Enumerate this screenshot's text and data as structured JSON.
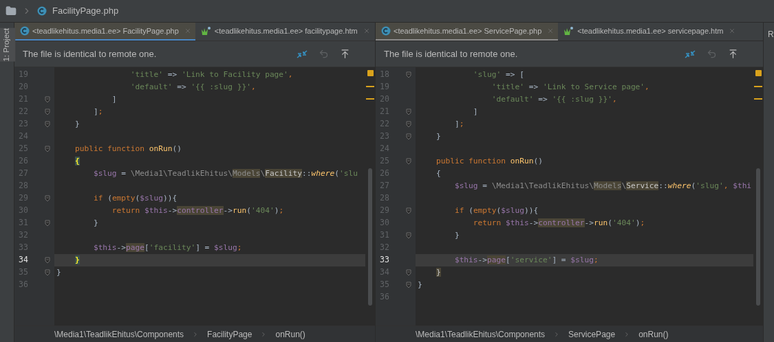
{
  "breadcrumb": {
    "file": "FacilityPage.php"
  },
  "left_strip": {
    "label": "1: Project"
  },
  "right_strip": {
    "label": "R"
  },
  "panes": [
    {
      "active": true,
      "tabs": [
        {
          "kind": "php",
          "label": "<teadlikehitus.media1.ee> FacilityPage.php",
          "selected": true
        },
        {
          "kind": "htm",
          "label": "<teadlikehitus.media1.ee> facilitypage.htm",
          "selected": false
        }
      ],
      "notice": "The file is identical to remote one.",
      "lines": [
        {
          "number": "19",
          "fold": false,
          "current": false,
          "tokens": [
            {
              "kind": "string",
              "text": "                'title'"
            },
            {
              "kind": "plain",
              "text": " => "
            },
            {
              "kind": "string",
              "text": "'Link to Facility page'"
            },
            {
              "kind": "punct",
              "text": ","
            }
          ]
        },
        {
          "number": "20",
          "fold": false,
          "current": false,
          "tokens": [
            {
              "kind": "string",
              "text": "                'default'"
            },
            {
              "kind": "plain",
              "text": " => "
            },
            {
              "kind": "string",
              "text": "'{{ :slug }}'"
            },
            {
              "kind": "punct",
              "text": ","
            }
          ]
        },
        {
          "number": "21",
          "fold": true,
          "current": false,
          "tokens": [
            {
              "kind": "plain",
              "text": "            ]"
            }
          ]
        },
        {
          "number": "22",
          "fold": true,
          "current": false,
          "tokens": [
            {
              "kind": "plain",
              "text": "        ]"
            },
            {
              "kind": "punct",
              "text": ";"
            }
          ]
        },
        {
          "number": "23",
          "fold": true,
          "current": false,
          "tokens": [
            {
              "kind": "plain",
              "text": "    }"
            }
          ]
        },
        {
          "number": "24",
          "fold": false,
          "current": false
        },
        {
          "number": "25",
          "fold": true,
          "current": false,
          "tokens": [
            {
              "kind": "keyword",
              "text": "    public function "
            },
            {
              "kind": "func",
              "text": "onRun"
            },
            {
              "kind": "plain",
              "text": "()"
            }
          ]
        },
        {
          "number": "26",
          "fold": false,
          "current": false,
          "tokens": [
            {
              "kind": "brace_match",
              "text": "    {"
            }
          ]
        },
        {
          "number": "27",
          "fold": false,
          "current": false,
          "tokens": [
            {
              "kind": "var",
              "text": "        $slug"
            },
            {
              "kind": "plain",
              "text": " = "
            },
            {
              "kind": "namespace",
              "text": "\\Media1\\TeadlikEhitus\\"
            },
            {
              "kind": "namespace_marked",
              "text": "Models"
            },
            {
              "kind": "namespace",
              "text": "\\"
            },
            {
              "kind": "plain_marked",
              "text": "Facility"
            },
            {
              "kind": "plain",
              "text": "::"
            },
            {
              "kind": "static",
              "text": "where"
            },
            {
              "kind": "plain",
              "text": "("
            },
            {
              "kind": "string",
              "text": "'slu"
            }
          ]
        },
        {
          "number": "28",
          "fold": false,
          "current": false
        },
        {
          "number": "29",
          "fold": true,
          "current": false,
          "tokens": [
            {
              "kind": "keyword",
              "text": "        if"
            },
            {
              "kind": "plain",
              "text": " ("
            },
            {
              "kind": "keyword",
              "text": "empty"
            },
            {
              "kind": "plain",
              "text": "("
            },
            {
              "kind": "var",
              "text": "$slug"
            },
            {
              "kind": "plain",
              "text": ")){"
            }
          ]
        },
        {
          "number": "30",
          "fold": false,
          "current": false,
          "tokens": [
            {
              "kind": "keyword",
              "text": "            return "
            },
            {
              "kind": "var",
              "text": "$this"
            },
            {
              "kind": "plain",
              "text": "->"
            },
            {
              "kind": "var_marked",
              "text": "controller"
            },
            {
              "kind": "plain",
              "text": "->"
            },
            {
              "kind": "func",
              "text": "run"
            },
            {
              "kind": "plain",
              "text": "("
            },
            {
              "kind": "string",
              "text": "'404'"
            },
            {
              "kind": "plain",
              "text": ")"
            },
            {
              "kind": "punct",
              "text": ";"
            }
          ]
        },
        {
          "number": "31",
          "fold": true,
          "current": false,
          "tokens": [
            {
              "kind": "plain",
              "text": "        }"
            }
          ]
        },
        {
          "number": "32",
          "fold": false,
          "current": false
        },
        {
          "number": "33",
          "fold": false,
          "current": false,
          "tokens": [
            {
              "kind": "var",
              "text": "        $this"
            },
            {
              "kind": "plain",
              "text": "->"
            },
            {
              "kind": "var_marked",
              "text": "page"
            },
            {
              "kind": "plain",
              "text": "["
            },
            {
              "kind": "string",
              "text": "'facility'"
            },
            {
              "kind": "plain",
              "text": "] = "
            },
            {
              "kind": "var",
              "text": "$slug"
            },
            {
              "kind": "punct",
              "text": ";"
            }
          ]
        },
        {
          "number": "34",
          "fold": true,
          "current": true,
          "tokens": [
            {
              "kind": "brace_match",
              "text": "    }"
            }
          ]
        },
        {
          "number": "35",
          "fold": true,
          "current": false,
          "tokens": [
            {
              "kind": "plain",
              "text": "}"
            }
          ]
        },
        {
          "number": "36",
          "fold": false,
          "current": false
        }
      ],
      "path": [
        "\\Media1\\TeadlikEhitus\\Components",
        "FacilityPage",
        "onRun()"
      ]
    },
    {
      "active": false,
      "tabs": [
        {
          "kind": "php",
          "label": "<teadlikehitus.media1.ee> ServicePage.php",
          "selected": true
        },
        {
          "kind": "htm",
          "label": "<teadlikehitus.media1.ee> servicepage.htm",
          "selected": false
        }
      ],
      "notice": "The file is identical to remote one.",
      "lines": [
        {
          "number": "18",
          "fold": true,
          "current": false,
          "tokens": [
            {
              "kind": "string",
              "text": "            'slug'"
            },
            {
              "kind": "plain",
              "text": " => ["
            }
          ]
        },
        {
          "number": "19",
          "fold": false,
          "current": false,
          "tokens": [
            {
              "kind": "string",
              "text": "                'title'"
            },
            {
              "kind": "plain",
              "text": " => "
            },
            {
              "kind": "string",
              "text": "'Link to Service page'"
            },
            {
              "kind": "punct",
              "text": ","
            }
          ]
        },
        {
          "number": "20",
          "fold": false,
          "current": false,
          "tokens": [
            {
              "kind": "string",
              "text": "                'default'"
            },
            {
              "kind": "plain",
              "text": " => "
            },
            {
              "kind": "string",
              "text": "'{{ :slug }}'"
            },
            {
              "kind": "punct",
              "text": ","
            }
          ]
        },
        {
          "number": "21",
          "fold": true,
          "current": false,
          "tokens": [
            {
              "kind": "plain",
              "text": "            ]"
            }
          ]
        },
        {
          "number": "22",
          "fold": true,
          "current": false,
          "tokens": [
            {
              "kind": "plain",
              "text": "        ]"
            },
            {
              "kind": "punct",
              "text": ";"
            }
          ]
        },
        {
          "number": "23",
          "fold": true,
          "current": false,
          "tokens": [
            {
              "kind": "plain",
              "text": "    }"
            }
          ]
        },
        {
          "number": "24",
          "fold": false,
          "current": false
        },
        {
          "number": "25",
          "fold": true,
          "current": false,
          "tokens": [
            {
              "kind": "keyword",
              "text": "    public function "
            },
            {
              "kind": "func",
              "text": "onRun"
            },
            {
              "kind": "plain",
              "text": "()"
            }
          ]
        },
        {
          "number": "26",
          "fold": false,
          "current": false,
          "tokens": [
            {
              "kind": "plain",
              "text": "    {"
            }
          ]
        },
        {
          "number": "27",
          "fold": false,
          "current": false,
          "tokens": [
            {
              "kind": "var",
              "text": "        $slug"
            },
            {
              "kind": "plain",
              "text": " = "
            },
            {
              "kind": "namespace",
              "text": "\\Media1\\TeadlikEhitus\\"
            },
            {
              "kind": "namespace_marked",
              "text": "Models"
            },
            {
              "kind": "namespace",
              "text": "\\"
            },
            {
              "kind": "plain_marked",
              "text": "Service"
            },
            {
              "kind": "plain",
              "text": "::"
            },
            {
              "kind": "static",
              "text": "where"
            },
            {
              "kind": "plain",
              "text": "("
            },
            {
              "kind": "string",
              "text": "'slug'"
            },
            {
              "kind": "punct",
              "text": ", "
            },
            {
              "kind": "var",
              "text": "$thi"
            }
          ]
        },
        {
          "number": "28",
          "fold": false,
          "current": false
        },
        {
          "number": "29",
          "fold": true,
          "current": false,
          "tokens": [
            {
              "kind": "keyword",
              "text": "        if"
            },
            {
              "kind": "plain",
              "text": " ("
            },
            {
              "kind": "keyword",
              "text": "empty"
            },
            {
              "kind": "plain",
              "text": "("
            },
            {
              "kind": "var",
              "text": "$slug"
            },
            {
              "kind": "plain",
              "text": ")){"
            }
          ]
        },
        {
          "number": "30",
          "fold": false,
          "current": false,
          "tokens": [
            {
              "kind": "keyword",
              "text": "            return "
            },
            {
              "kind": "var",
              "text": "$this"
            },
            {
              "kind": "plain",
              "text": "->"
            },
            {
              "kind": "var_marked",
              "text": "controller"
            },
            {
              "kind": "plain",
              "text": "->"
            },
            {
              "kind": "func",
              "text": "run"
            },
            {
              "kind": "plain",
              "text": "("
            },
            {
              "kind": "string",
              "text": "'404'"
            },
            {
              "kind": "plain",
              "text": ")"
            },
            {
              "kind": "punct",
              "text": ";"
            }
          ]
        },
        {
          "number": "31",
          "fold": true,
          "current": false,
          "tokens": [
            {
              "kind": "plain",
              "text": "        }"
            }
          ]
        },
        {
          "number": "32",
          "fold": false,
          "current": false
        },
        {
          "number": "33",
          "fold": false,
          "current": true,
          "tokens": [
            {
              "kind": "var",
              "text": "        $this"
            },
            {
              "kind": "plain",
              "text": "->"
            },
            {
              "kind": "var_marked",
              "text": "page"
            },
            {
              "kind": "plain",
              "text": "["
            },
            {
              "kind": "string",
              "text": "'service'"
            },
            {
              "kind": "plain",
              "text": "] = "
            },
            {
              "kind": "var",
              "text": "$slug"
            },
            {
              "kind": "punct",
              "text": ";"
            }
          ]
        },
        {
          "number": "34",
          "fold": true,
          "current": false,
          "tokens": [
            {
              "kind": "plain_marked",
              "text": "    }"
            }
          ]
        },
        {
          "number": "35",
          "fold": true,
          "current": false,
          "tokens": [
            {
              "kind": "plain",
              "text": "}"
            }
          ]
        },
        {
          "number": "36",
          "fold": false,
          "current": false
        }
      ],
      "path": [
        "\\Media1\\TeadlikEhitus\\Components",
        "ServicePage",
        "onRun()"
      ]
    }
  ]
}
